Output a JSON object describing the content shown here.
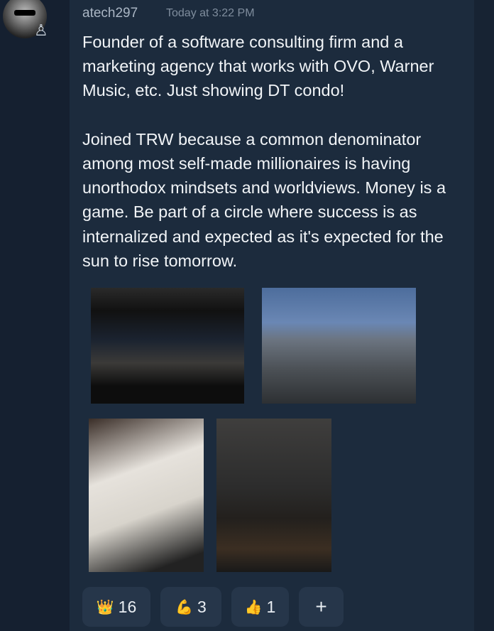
{
  "message": {
    "username": "atech297",
    "timestamp": "Today at 3:22 PM",
    "role_icon": "chess-pawn-icon",
    "body": "Founder of a software consulting firm and a marketing agency that works with OVO, Warner Music, etc. Just showing DT condo!\n\nJoined TRW because a common denominator among most self-made millionaires is having unorthodox mindsets and worldviews. Money is a game. Be part of a circle where success is as internalized and expected as it's expected for the sun to rise tomorrow."
  },
  "reactions": [
    {
      "emoji": "👑",
      "count": "16"
    },
    {
      "emoji": "💪",
      "count": "3"
    },
    {
      "emoji": "👍",
      "count": "1"
    }
  ],
  "add_reaction_label": "+"
}
